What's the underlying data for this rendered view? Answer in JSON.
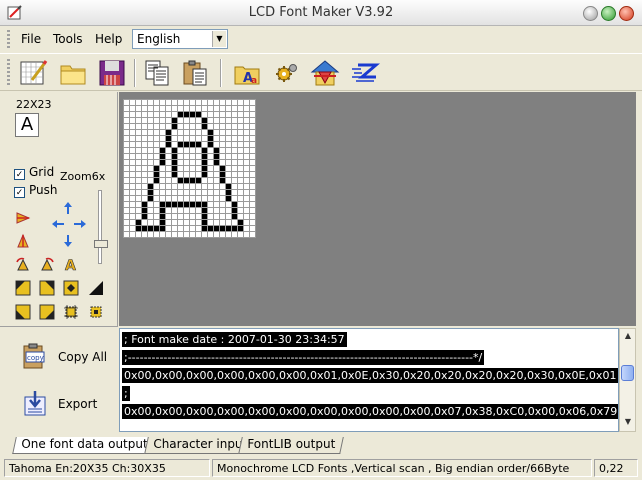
{
  "window": {
    "title": "LCD Font Maker V3.92"
  },
  "menu": {
    "file": "File",
    "tools": "Tools",
    "help": "Help",
    "language": "English"
  },
  "toolbar_icons": [
    "new-font-icon",
    "open-folder-icon",
    "save-disk-icon",
    "copy-icon",
    "paste-icon",
    "font-preview-icon",
    "settings-gear-icon",
    "import-house-icon",
    "export-z-icon"
  ],
  "left_panel": {
    "font_size": "22X23",
    "preview_char": "A",
    "grid_label": "Grid",
    "grid_checked": "✓",
    "push_label": "Push",
    "push_checked": "✓",
    "zoom_label": "Zoom6x"
  },
  "actions": {
    "copy_all": "Copy All",
    "export": "Export"
  },
  "output_lines": [
    "; Font make date  : 2007-01-30 23:34:57",
    ";---------------------------------------------------------------------------------------*/",
    "0x00,0x00,0x00,0x00,0x00,0x00,0x01,0x0E,0x30,0x20,0x20,0x20,0x20,0x30,0x0E,0x01",
    ";",
    "0x00,0x00,0x00,0x00,0x00,0x00,0x00,0x00,0x00,0x00,0x07,0x38,0xC0,0x00,0x06,0x79"
  ],
  "tabs": {
    "font_data": "One font data output",
    "char_input": "Character input",
    "fontlib": "FontLIB output"
  },
  "status": {
    "font_info": "Tahoma En:20X35 Ch:30X35",
    "mode_info": "Monochrome LCD Fonts ,Vertical scan , Big endian order/66Byte",
    "coords": "0,22"
  },
  "glyph": {
    "cols": 22,
    "rows": 23,
    "pattern": [
      "......................",
      "......................",
      ".........XXXX.........",
      "........X....X........",
      "........X....X........",
      ".......X......X.......",
      ".......X......X.......",
      ".......X.XXXX.X.......",
      "......X.X....X.X......",
      "......X.X....X.X......",
      "......X.X....X.X......",
      ".....X..X....X..X.....",
      ".....X..X....X..X.....",
      ".....X...XXXX...X.....",
      "....X............X....",
      "....X............X....",
      "....X............X....",
      "...X..XXXXXXXX....X...",
      "...X..X......X....X...",
      "...X..X......X....X...",
      "..X...X......X.....X..",
      "..XXXXX......XXXXXXX..",
      "......................"
    ]
  }
}
